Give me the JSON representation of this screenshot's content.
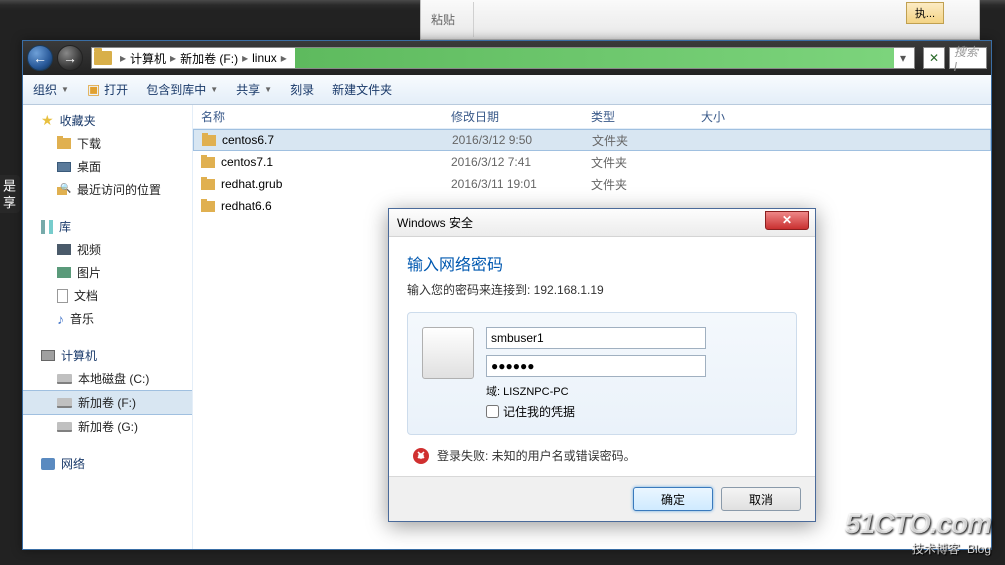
{
  "leftTab": "是\n享",
  "ribbonLabel": "粘贴",
  "execBtn": "执...",
  "breadcrumb": {
    "root": "计算机",
    "drive": "新加卷 (F:)",
    "folder": "linux"
  },
  "searchPlaceholder": "搜索 l",
  "toolbar": {
    "organize": "组织",
    "open": "打开",
    "include": "包含到库中",
    "share": "共享",
    "burn": "刻录",
    "newFolder": "新建文件夹"
  },
  "sidebar": {
    "favorites": "收藏夹",
    "favItems": [
      "下载",
      "桌面",
      "最近访问的位置"
    ],
    "library": "库",
    "libItems": [
      "视频",
      "图片",
      "文档",
      "音乐"
    ],
    "computer": "计算机",
    "drives": [
      "本地磁盘 (C:)",
      "新加卷 (F:)",
      "新加卷 (G:)"
    ],
    "network": "网络"
  },
  "columns": {
    "name": "名称",
    "date": "修改日期",
    "type": "类型",
    "size": "大小"
  },
  "files": [
    {
      "name": "centos6.7",
      "date": "2016/3/12 9:50",
      "type": "文件夹"
    },
    {
      "name": "centos7.1",
      "date": "2016/3/12 7:41",
      "type": "文件夹"
    },
    {
      "name": "redhat.grub",
      "date": "2016/3/11 19:01",
      "type": "文件夹"
    },
    {
      "name": "redhat6.6",
      "date": "",
      "type": ""
    }
  ],
  "dialog": {
    "title": "Windows 安全",
    "heading": "输入网络密码",
    "subtext": "输入您的密码来连接到: 192.168.1.19",
    "username": "smbuser1",
    "password": "●●●●●●",
    "domain": "域: LISZNPC-PC",
    "remember": "记住我的凭据",
    "error": "登录失败: 未知的用户名或错误密码。",
    "ok": "确定",
    "cancel": "取消"
  },
  "watermark": {
    "brand": "51CTO.com",
    "tagline": "技术博客",
    "blog": "Blog"
  }
}
